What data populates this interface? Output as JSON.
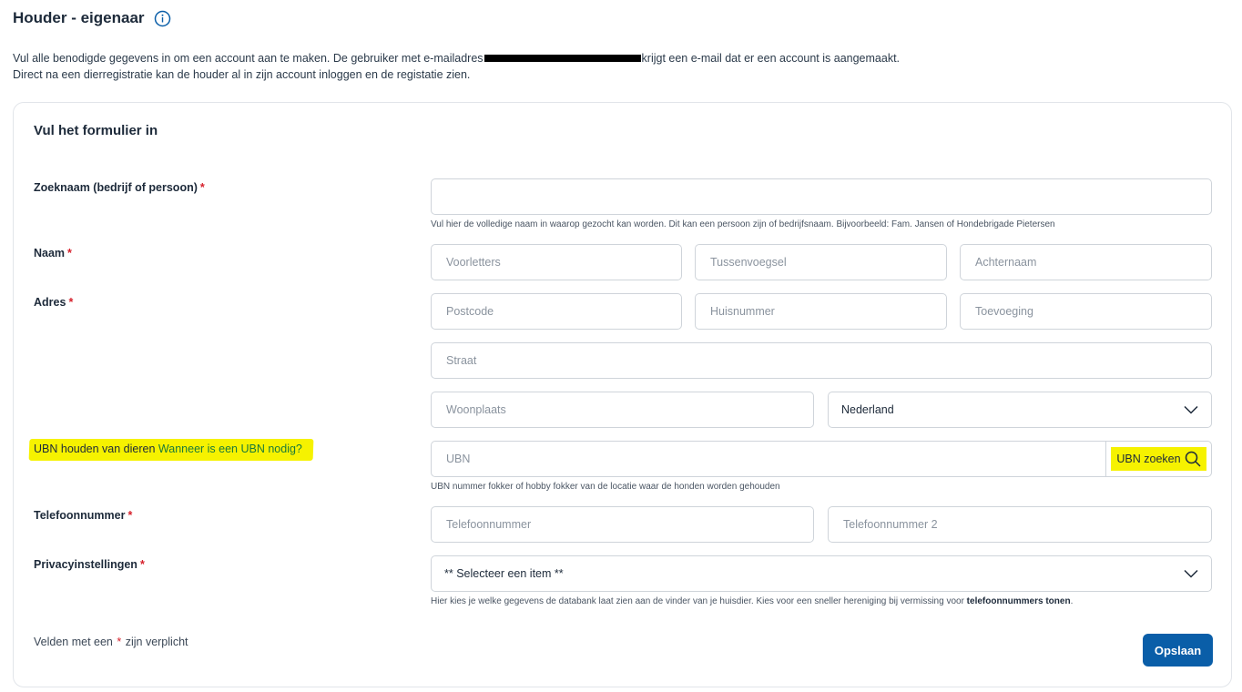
{
  "header": {
    "title": "Houder - eigenaar",
    "intro_line1_before": "Vul alle benodigde gegevens in om een account aan te maken. De gebruiker met e-mailadres",
    "intro_line1_after": "krijgt een e-mail dat er een account is aangemaakt.",
    "intro_line2": "Direct na een dierregistratie kan de houder al in zijn account inloggen en de registatie zien."
  },
  "form": {
    "title": "Vul het formulier in",
    "required_marker": "*",
    "zoeknaam": {
      "label": "Zoeknaam (bedrijf of persoon)",
      "value": "",
      "help": "Vul hier de volledige naam in waarop gezocht kan worden. Dit kan een persoon zijn of bedrijfsnaam. Bijvoorbeeld: Fam. Jansen of Hondebrigade Pietersen"
    },
    "naam": {
      "label": "Naam",
      "voorletters_placeholder": "Voorletters",
      "tussenvoegsel_placeholder": "Tussenvoegsel",
      "achternaam_placeholder": "Achternaam"
    },
    "adres": {
      "label": "Adres",
      "postcode_placeholder": "Postcode",
      "huisnummer_placeholder": "Huisnummer",
      "toevoeging_placeholder": "Toevoeging",
      "straat_placeholder": "Straat",
      "woonplaats_placeholder": "Woonplaats",
      "land_selected": "Nederland"
    },
    "ubn": {
      "label": "UBN houden van dieren",
      "link": "Wanneer is een UBN nodig?",
      "placeholder": "UBN",
      "search_label": "UBN zoeken",
      "help": "UBN nummer fokker of hobby fokker van de locatie waar de honden worden gehouden",
      "highlight_color": "#f6f200"
    },
    "telefoon": {
      "label": "Telefoonnummer",
      "placeholder1": "Telefoonnummer",
      "placeholder2": "Telefoonnummer 2"
    },
    "privacy": {
      "label": "Privacyinstellingen",
      "selected": "** Selecteer een item **",
      "help_before": "Hier kies je welke gegevens de databank laat zien aan de vinder van je huisdier. Kies voor een sneller hereniging bij vermissing voor ",
      "help_bold": "telefoonnummers tonen",
      "help_after": "."
    },
    "footer_before": "Velden met een",
    "footer_after": "zijn verplicht",
    "save_label": "Opslaan"
  },
  "colors": {
    "primary_button": "#0a5ea8",
    "required": "#d6202b",
    "link": "#1a7a3a"
  },
  "icons": [
    "info-icon",
    "chevron-down-icon",
    "search-icon"
  ]
}
